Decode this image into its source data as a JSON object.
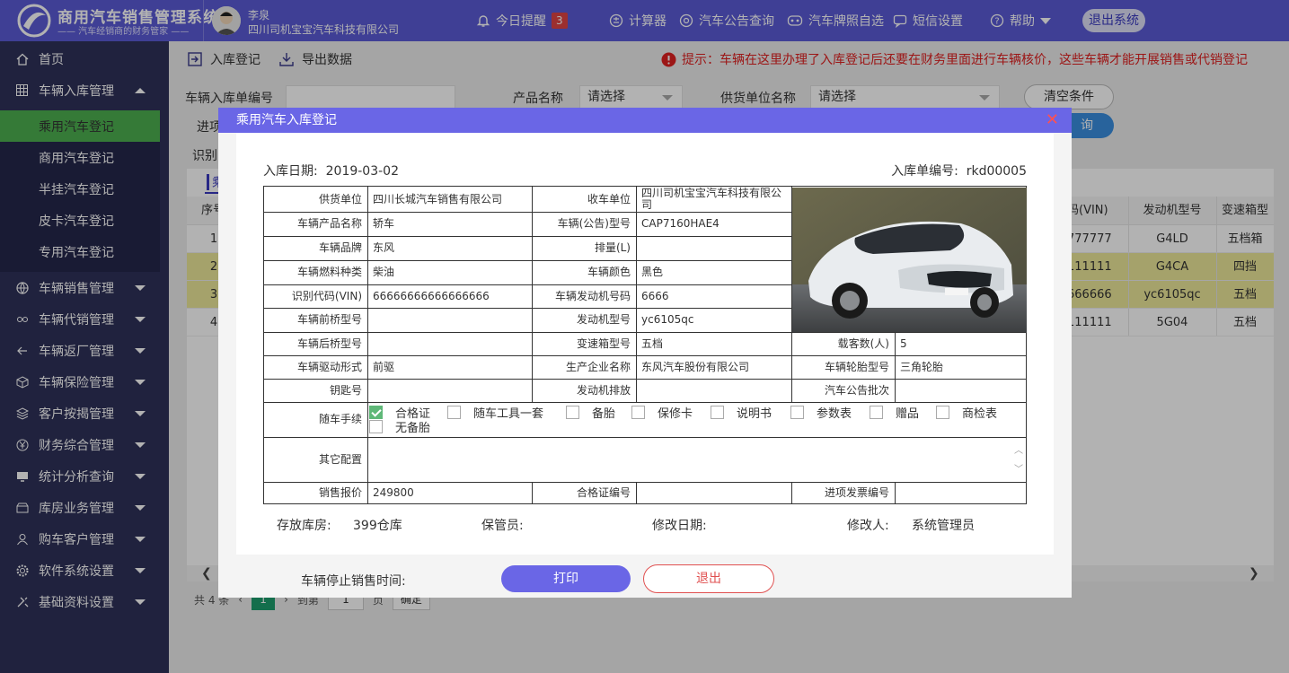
{
  "header": {
    "brand_title": "商用汽车销售管理系统",
    "brand_subtitle": "—— 汽车经销商的财务管家 ——",
    "user_name": "李泉",
    "company": "四川司机宝宝汽车科技有限公司",
    "reminder_label": "今日提醒",
    "reminder_count": "3",
    "calculator": "计算器",
    "announcement_query": "汽车公告查询",
    "plate_select": "汽车牌照自选",
    "sms_settings": "短信设置",
    "help": "帮助",
    "logout": "退出系统"
  },
  "sidebar": {
    "home": "首页",
    "stock_mgmt": "车辆入库管理",
    "sub": [
      "乘用汽车登记",
      "商用汽车登记",
      "半挂汽车登记",
      "皮卡汽车登记",
      "专用汽车登记"
    ],
    "items": [
      "车辆销售管理",
      "车辆代销管理",
      "车辆返厂管理",
      "车辆保险管理",
      "客户按揭管理",
      "财务综合管理",
      "统计分析查询",
      "库房业务管理",
      "购车客户管理",
      "软件系统设置",
      "基础资料设置"
    ]
  },
  "toolbar": {
    "stock_in": "入库登记",
    "export": "导出数据",
    "tip": "提示：车辆在这里办理了入库登记后还要在财务里面进行车辆核价，这些车辆才能开展销售或代销登记"
  },
  "filters": {
    "order_no_label": "车辆入库单编号",
    "product_label": "产品名称",
    "product_value": "请选择",
    "supplier_label": "供货单位名称",
    "supplier_value": "请选择",
    "clear": "清空条件",
    "query": "询",
    "row2_label": "进项",
    "row3_label": "识别"
  },
  "grid": {
    "tab_label": "乘",
    "headers": {
      "seq": "序号",
      "vin": "码(VIN)",
      "engine": "发动机型号",
      "gearbox": "变速箱型"
    },
    "rows": [
      {
        "seq": "1",
        "vin": "777777",
        "engine": "G4LD",
        "gearbox": "五档箱"
      },
      {
        "seq": "2",
        "vin": "111111",
        "engine": "G4CA",
        "gearbox": "四挡"
      },
      {
        "seq": "3",
        "vin": "666666",
        "engine": "yc6105qc",
        "gearbox": "五档"
      },
      {
        "seq": "4",
        "vin": "111111",
        "engine": "5G04",
        "gearbox": "五档"
      }
    ]
  },
  "pager": {
    "total": "共 4 条",
    "current": "1",
    "goto": "到第",
    "page_input": "1",
    "page_unit": "页",
    "confirm": "确定"
  },
  "modal": {
    "title": "乘用汽车入库登记",
    "date_label": "入库日期:",
    "date_value": "2019-03-02",
    "no_label": "入库单编号:",
    "no_value": "rkd00005",
    "fields": {
      "supplier_l": "供货单位",
      "supplier_v": "四川长城汽车销售有限公司",
      "receiver_l": "收车单位",
      "receiver_v": "四川司机宝宝汽车科技有限公司",
      "product_l": "车辆产品名称",
      "product_v": "轿车",
      "model_l": "车辆(公告)型号",
      "model_v": "CAP7160HAE4",
      "brand_l": "车辆品牌",
      "brand_v": "东风",
      "disp_l": "排量(L)",
      "disp_v": "",
      "fuel_l": "车辆燃料种类",
      "fuel_v": "柴油",
      "color_l": "车辆颜色",
      "color_v": "黑色",
      "vin_l": "识别代码(VIN)",
      "vin_v": "66666666666666666",
      "engno_l": "车辆发动机号码",
      "engno_v": "6666",
      "front_l": "车辆前桥型号",
      "front_v": "",
      "engmodel_l": "发动机型号",
      "engmodel_v": "yc6105qc",
      "rear_l": "车辆后桥型号",
      "rear_v": "",
      "gear_l": "变速箱型号",
      "gear_v": "五档",
      "seats_l": "载客数(人)",
      "seats_v": "5",
      "drive_l": "车辆驱动形式",
      "drive_v": "前驱",
      "maker_l": "生产企业名称",
      "maker_v": "东风汽车股份有限公司",
      "tire_l": "车辆轮胎型号",
      "tire_v": "三角轮胎",
      "key_l": "钥匙号",
      "key_v": "",
      "emis_l": "发动机排放",
      "emis_v": "",
      "batch_l": "汽车公告批次",
      "batch_v": "",
      "docs_l": "随车手续",
      "other_l": "其它配置",
      "price_l": "销售报价",
      "price_v": "249800",
      "cert_l": "合格证编号",
      "cert_v": "",
      "invoice_l": "进项发票编号",
      "invoice_v": ""
    },
    "checks": [
      "合格证",
      "随车工具一套",
      "备胎",
      "保修卡",
      "说明书",
      "参数表",
      "赠品",
      "商检表",
      "无备胎"
    ],
    "footer": {
      "warehouse_l": "存放库房:",
      "warehouse_v": "399仓库",
      "keeper_l": "保管员:",
      "modified_l": "修改日期:",
      "modifier_l": "修改人:",
      "modifier_v": "系统管理员",
      "stop_l": "车辆停止销售时间:"
    },
    "print": "打印",
    "exit": "退出"
  }
}
